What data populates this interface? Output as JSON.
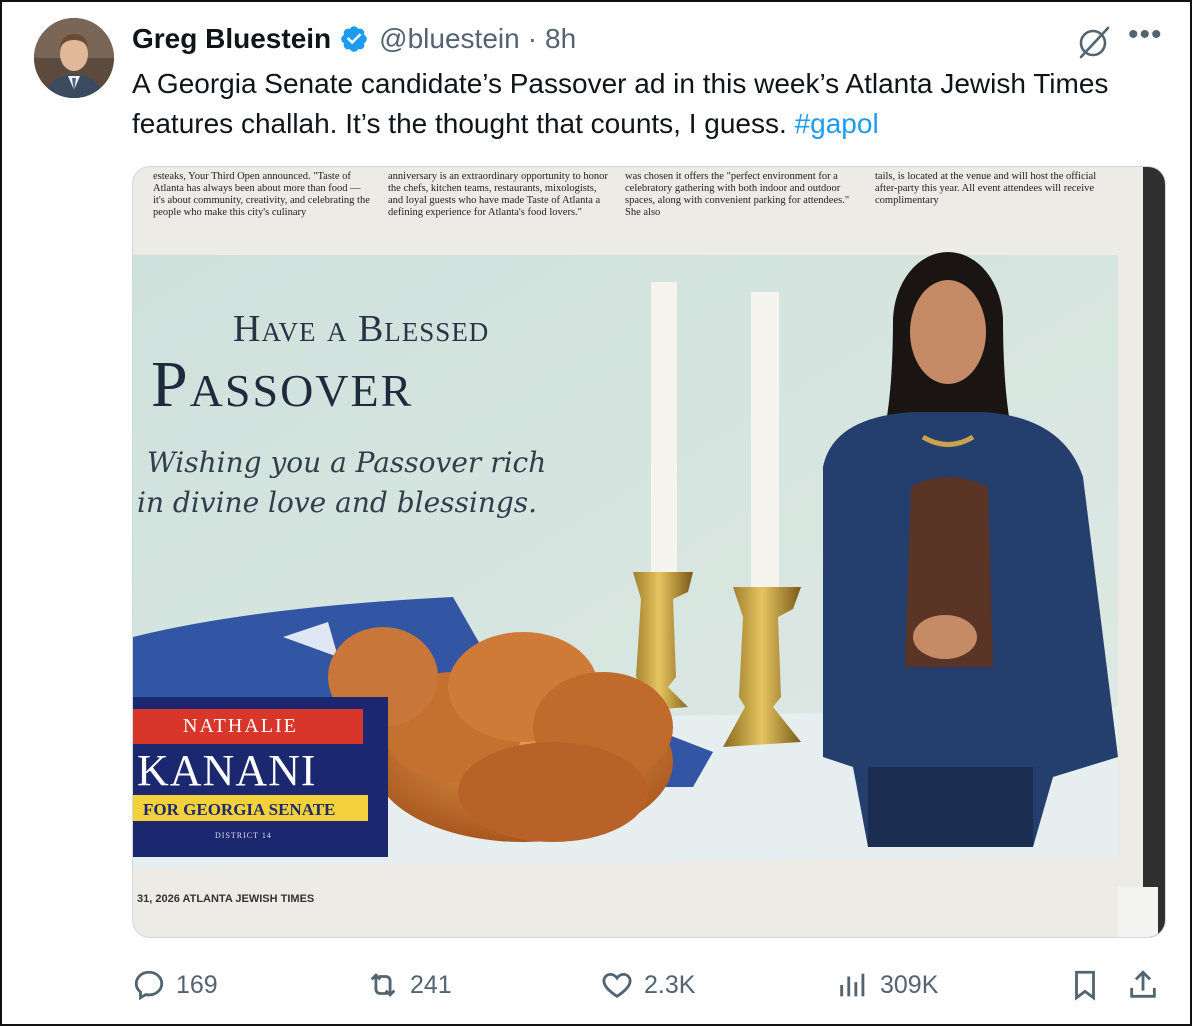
{
  "tweet": {
    "author_name": "Greg Bluestein",
    "handle": "@bluestein",
    "separator": "·",
    "time": "8h",
    "text": "A Georgia Senate candidate’s Passover ad in this week’s Atlanta Jewish Times features challah. It’s the thought that counts, I guess. ",
    "hashtag": "#gapol"
  },
  "media": {
    "newspaper_columns": [
      "esteaks, Your Third Open announced. \"Taste of Atlanta has always been about more than food — it's about community, creativity, and celebrating the people who make this city's culinary",
      "anniversary is an extraordinary opportunity to honor the chefs, kitchen teams, restaurants, mixologists, and loyal guests who have made Taste of Atlanta a defining experience for Atlanta's food lovers.\"",
      "was chosen it offers the \"perfect environment for a celebratory gathering with both indoor and outdoor spaces, along with convenient parking for attendees.\" She also",
      "tails, is located at the venue and will host the official after-party this year. All event attendees will receive complimentary"
    ],
    "ad_title_line1": "Have a Blessed",
    "ad_title_line2": "Passover",
    "ad_subtitle_line1": "Wishing you a Passover rich",
    "ad_subtitle_line2": "in divine love and blessings.",
    "sign_first_name": "NATHALIE",
    "sign_last_name": "KANANI",
    "sign_for": "FOR GEORGIA SENATE",
    "sign_district": "DISTRICT 14",
    "page_footer": "31, 2026 ATLANTA JEWISH TIMES"
  },
  "actions": {
    "replies": "169",
    "reposts": "241",
    "likes": "2.3K",
    "views": "309K"
  },
  "icons": {
    "verified": "verified-badge-icon",
    "grok": "grok-icon",
    "more": "more-icon",
    "reply": "reply-icon",
    "repost": "repost-icon",
    "like": "heart-icon",
    "views": "views-icon",
    "bookmark": "bookmark-icon",
    "share": "share-icon"
  },
  "colors": {
    "link": "#1d9bf0",
    "verified": "#1d9bf0",
    "muted": "#536471"
  }
}
